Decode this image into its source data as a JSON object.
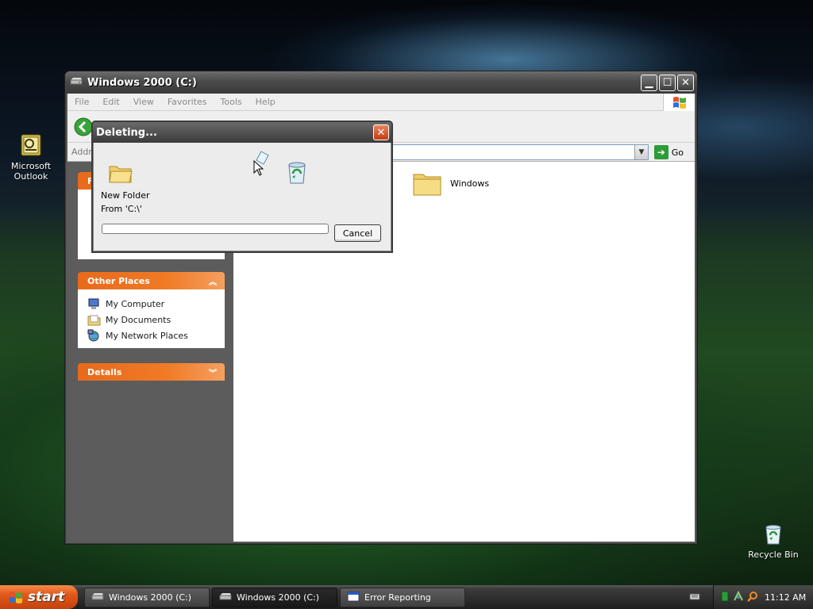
{
  "desktop": {
    "icons": [
      {
        "name": "outlook",
        "label": "Microsoft\nOutlook"
      },
      {
        "name": "recycle-bin",
        "label": "Recycle Bin"
      }
    ]
  },
  "explorer": {
    "title": "Windows 2000 (C:)",
    "menu": [
      "File",
      "Edit",
      "View",
      "Favorites",
      "Tools",
      "Help"
    ],
    "address_label": "Addre",
    "go_label": "Go",
    "panels": {
      "file_tasks_header_initial": "F",
      "other_places": {
        "title": "Other Places",
        "items": [
          {
            "label": "My Computer",
            "icon": "my-computer-icon"
          },
          {
            "label": "My Documents",
            "icon": "my-documents-icon"
          },
          {
            "label": "My Network Places",
            "icon": "my-network-places-icon"
          }
        ]
      },
      "details": {
        "title": "Details"
      }
    },
    "files": [
      {
        "label": "Windows",
        "icon": "folder-icon"
      }
    ]
  },
  "dialog": {
    "title": "Deleting...",
    "item_name": "New Folder",
    "from_text": "From 'C:\\'",
    "cancel_label": "Cancel",
    "progress": 0
  },
  "taskbar": {
    "start_label": "start",
    "tasks": [
      {
        "label": "Windows 2000 (C:)",
        "active": false
      },
      {
        "label": "Windows 2000 (C:)",
        "active": true
      },
      {
        "label": "Error Reporting",
        "active": false
      }
    ],
    "clock": "11:12 AM"
  },
  "colors": {
    "accent_orange": "#e86a1c",
    "window_frame": "#4a4a4a"
  }
}
